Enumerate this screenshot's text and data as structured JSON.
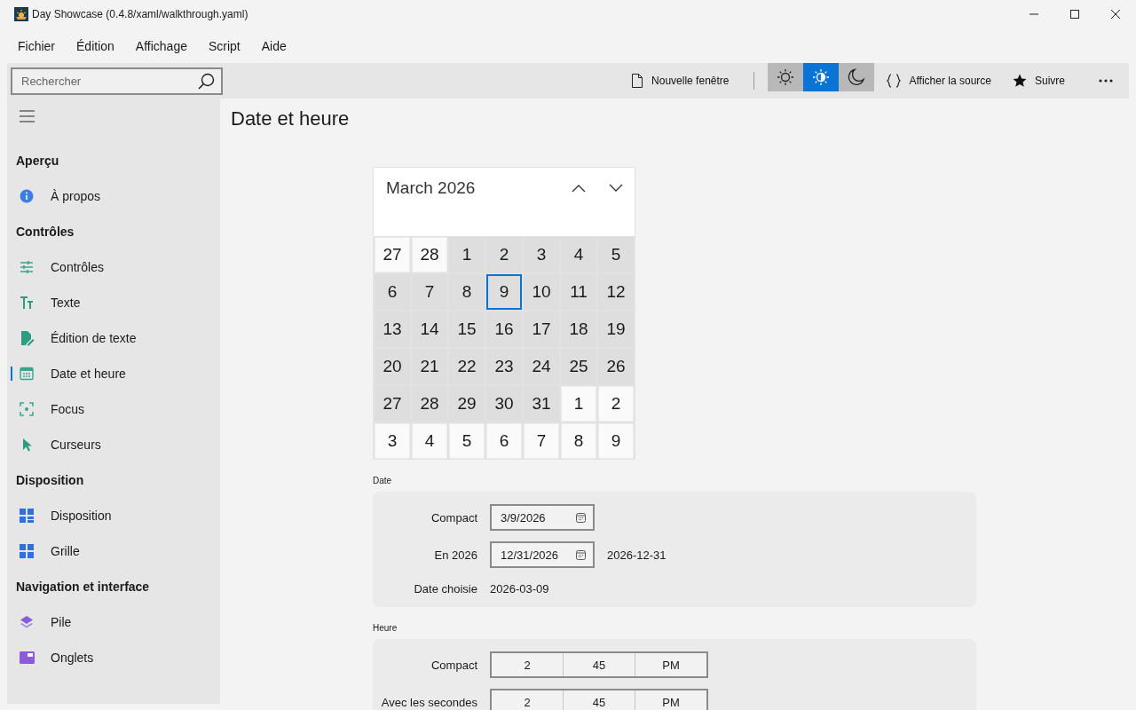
{
  "window": {
    "title": "Day Showcase (0.4.8/xaml/walkthrough.yaml)"
  },
  "menu": [
    "Fichier",
    "Édition",
    "Affichage",
    "Script",
    "Aide"
  ],
  "search": {
    "placeholder": "Rechercher"
  },
  "toolbar": {
    "new_window": "Nouvelle fenêtre",
    "themes": [
      {
        "kind": "light",
        "selected": false
      },
      {
        "kind": "auto",
        "selected": true
      },
      {
        "kind": "dark",
        "selected": false
      }
    ],
    "view_source": "Afficher la source",
    "follow": "Suivre"
  },
  "sidebar": {
    "groups": [
      {
        "title": "Aperçu",
        "items": [
          {
            "label": "À propos",
            "kind": "info",
            "selected": false
          }
        ]
      },
      {
        "title": "Contrôles",
        "items": [
          {
            "label": "Contrôles",
            "kind": "sliders",
            "selected": false
          },
          {
            "label": "Texte",
            "kind": "text",
            "selected": false
          },
          {
            "label": "Édition de texte",
            "kind": "edit",
            "selected": false
          },
          {
            "label": "Date et heure",
            "kind": "calendar",
            "selected": true
          },
          {
            "label": "Focus",
            "kind": "focus",
            "selected": false
          },
          {
            "label": "Curseurs",
            "kind": "cursor",
            "selected": false
          }
        ]
      },
      {
        "title": "Disposition",
        "items": [
          {
            "label": "Disposition",
            "kind": "layout",
            "selected": false
          },
          {
            "label": "Grille",
            "kind": "grid",
            "selected": false
          }
        ]
      },
      {
        "title": "Navigation et interface",
        "items": [
          {
            "label": "Pile",
            "kind": "stack",
            "selected": false
          },
          {
            "label": "Onglets",
            "kind": "tabs",
            "selected": false
          }
        ]
      }
    ]
  },
  "page": {
    "title": "Date et heure"
  },
  "calendar": {
    "month": "March 2026",
    "days": [
      {
        "day": "27",
        "in_month": false,
        "selected": false
      },
      {
        "day": "28",
        "in_month": false,
        "selected": false
      },
      {
        "day": "1",
        "in_month": true,
        "selected": false
      },
      {
        "day": "2",
        "in_month": true,
        "selected": false
      },
      {
        "day": "3",
        "in_month": true,
        "selected": false
      },
      {
        "day": "4",
        "in_month": true,
        "selected": false
      },
      {
        "day": "5",
        "in_month": true,
        "selected": false
      },
      {
        "day": "6",
        "in_month": true,
        "selected": false
      },
      {
        "day": "7",
        "in_month": true,
        "selected": false
      },
      {
        "day": "8",
        "in_month": true,
        "selected": false
      },
      {
        "day": "9",
        "in_month": true,
        "selected": true
      },
      {
        "day": "10",
        "in_month": true,
        "selected": false
      },
      {
        "day": "11",
        "in_month": true,
        "selected": false
      },
      {
        "day": "12",
        "in_month": true,
        "selected": false
      },
      {
        "day": "13",
        "in_month": true,
        "selected": false
      },
      {
        "day": "14",
        "in_month": true,
        "selected": false
      },
      {
        "day": "15",
        "in_month": true,
        "selected": false
      },
      {
        "day": "16",
        "in_month": true,
        "selected": false
      },
      {
        "day": "17",
        "in_month": true,
        "selected": false
      },
      {
        "day": "18",
        "in_month": true,
        "selected": false
      },
      {
        "day": "19",
        "in_month": true,
        "selected": false
      },
      {
        "day": "20",
        "in_month": true,
        "selected": false
      },
      {
        "day": "21",
        "in_month": true,
        "selected": false
      },
      {
        "day": "22",
        "in_month": true,
        "selected": false
      },
      {
        "day": "23",
        "in_month": true,
        "selected": false
      },
      {
        "day": "24",
        "in_month": true,
        "selected": false
      },
      {
        "day": "25",
        "in_month": true,
        "selected": false
      },
      {
        "day": "26",
        "in_month": true,
        "selected": false
      },
      {
        "day": "27",
        "in_month": true,
        "selected": false
      },
      {
        "day": "28",
        "in_month": true,
        "selected": false
      },
      {
        "day": "29",
        "in_month": true,
        "selected": false
      },
      {
        "day": "30",
        "in_month": true,
        "selected": false
      },
      {
        "day": "31",
        "in_month": true,
        "selected": false
      },
      {
        "day": "1",
        "in_month": false,
        "selected": false
      },
      {
        "day": "2",
        "in_month": false,
        "selected": false
      },
      {
        "day": "3",
        "in_month": false,
        "selected": false
      },
      {
        "day": "4",
        "in_month": false,
        "selected": false
      },
      {
        "day": "5",
        "in_month": false,
        "selected": false
      },
      {
        "day": "6",
        "in_month": false,
        "selected": false
      },
      {
        "day": "7",
        "in_month": false,
        "selected": false
      },
      {
        "day": "8",
        "in_month": false,
        "selected": false
      },
      {
        "day": "9",
        "in_month": false,
        "selected": false
      }
    ]
  },
  "sections": [
    {
      "title": "Date",
      "rows": [
        {
          "kind": "date",
          "label": "Compact",
          "value": "3/9/2026"
        },
        {
          "kind": "date",
          "label": "En 2026",
          "value": "12/31/2026",
          "note": "2026-12-31"
        },
        {
          "kind": "text",
          "label": "Date choisie",
          "value": "2026-03-09"
        }
      ]
    },
    {
      "title": "Heure",
      "rows": [
        {
          "kind": "time",
          "label": "Compact",
          "hour": "2",
          "minute": "45",
          "period": "PM"
        },
        {
          "kind": "time",
          "label": "Avec les secondes",
          "hour": "2",
          "minute": "45",
          "period": "PM"
        }
      ]
    }
  ]
}
